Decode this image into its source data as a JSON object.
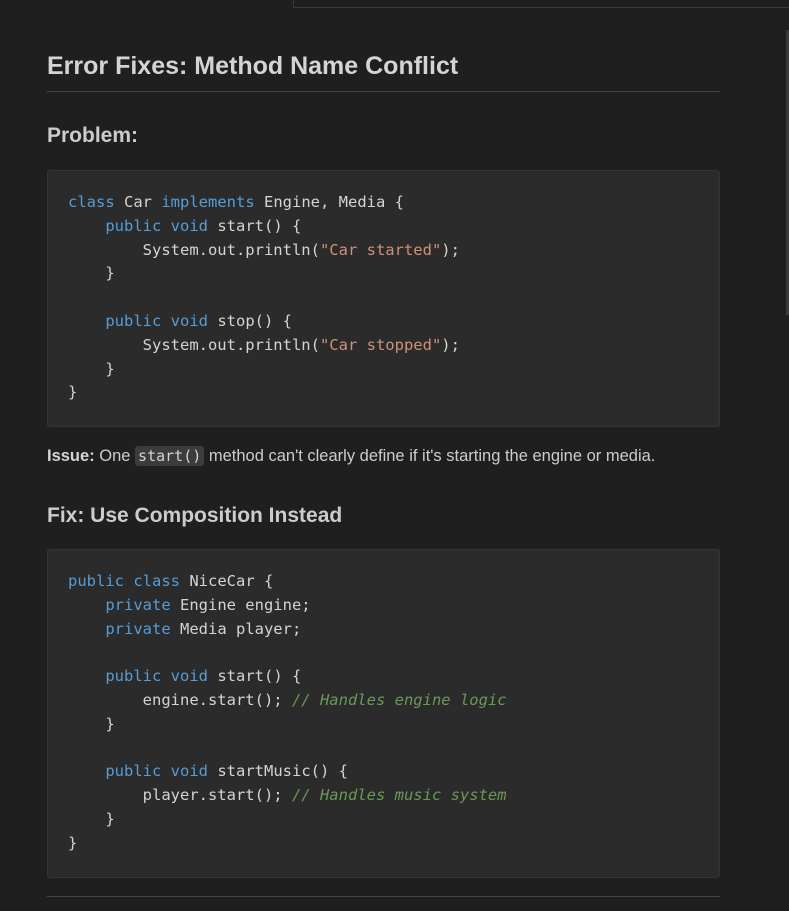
{
  "heading": "Error Fixes: Method Name Conflict",
  "problem": {
    "heading": "Problem:",
    "code": [
      [
        {
          "t": "kw",
          "v": "class"
        },
        {
          "t": "",
          "v": " Car "
        },
        {
          "t": "kw",
          "v": "implements"
        },
        {
          "t": "",
          "v": " Engine, Media {"
        }
      ],
      [
        {
          "t": "",
          "v": "    "
        },
        {
          "t": "kw",
          "v": "public"
        },
        {
          "t": "",
          "v": " "
        },
        {
          "t": "kw",
          "v": "void"
        },
        {
          "t": "",
          "v": " start() {"
        }
      ],
      [
        {
          "t": "",
          "v": "        System.out.println("
        },
        {
          "t": "str",
          "v": "\"Car started\""
        },
        {
          "t": "",
          "v": ");"
        }
      ],
      [
        {
          "t": "",
          "v": "    }"
        }
      ],
      [
        {
          "t": "",
          "v": ""
        }
      ],
      [
        {
          "t": "",
          "v": "    "
        },
        {
          "t": "kw",
          "v": "public"
        },
        {
          "t": "",
          "v": " "
        },
        {
          "t": "kw",
          "v": "void"
        },
        {
          "t": "",
          "v": " stop() {"
        }
      ],
      [
        {
          "t": "",
          "v": "        System.out.println("
        },
        {
          "t": "str",
          "v": "\"Car stopped\""
        },
        {
          "t": "",
          "v": ");"
        }
      ],
      [
        {
          "t": "",
          "v": "    }"
        }
      ],
      [
        {
          "t": "",
          "v": "}"
        }
      ]
    ]
  },
  "issue": {
    "label": "Issue:",
    "before": " One ",
    "code": "start()",
    "after": " method can't clearly define if it's starting the engine or media."
  },
  "fix": {
    "heading": "Fix: Use Composition Instead",
    "code": [
      [
        {
          "t": "kw",
          "v": "public"
        },
        {
          "t": "",
          "v": " "
        },
        {
          "t": "kw",
          "v": "class"
        },
        {
          "t": "",
          "v": " NiceCar {"
        }
      ],
      [
        {
          "t": "",
          "v": "    "
        },
        {
          "t": "kw",
          "v": "private"
        },
        {
          "t": "",
          "v": " Engine engine;"
        }
      ],
      [
        {
          "t": "",
          "v": "    "
        },
        {
          "t": "kw",
          "v": "private"
        },
        {
          "t": "",
          "v": " Media player;"
        }
      ],
      [
        {
          "t": "",
          "v": ""
        }
      ],
      [
        {
          "t": "",
          "v": "    "
        },
        {
          "t": "kw",
          "v": "public"
        },
        {
          "t": "",
          "v": " "
        },
        {
          "t": "kw",
          "v": "void"
        },
        {
          "t": "",
          "v": " start() {"
        }
      ],
      [
        {
          "t": "",
          "v": "        engine.start(); "
        },
        {
          "t": "cmt",
          "v": "// Handles engine logic"
        }
      ],
      [
        {
          "t": "",
          "v": "    }"
        }
      ],
      [
        {
          "t": "",
          "v": ""
        }
      ],
      [
        {
          "t": "",
          "v": "    "
        },
        {
          "t": "kw",
          "v": "public"
        },
        {
          "t": "",
          "v": " "
        },
        {
          "t": "kw",
          "v": "void"
        },
        {
          "t": "",
          "v": " startMusic() {"
        }
      ],
      [
        {
          "t": "",
          "v": "        player.start(); "
        },
        {
          "t": "cmt",
          "v": "// Handles music system"
        }
      ],
      [
        {
          "t": "",
          "v": "    }"
        }
      ],
      [
        {
          "t": "",
          "v": "}"
        }
      ]
    ]
  },
  "colors": {
    "keyword": "#569cd6",
    "string": "#ce9178",
    "comment": "#6a9955",
    "background": "#1f1f1f",
    "code_background": "#2b2b2b"
  }
}
